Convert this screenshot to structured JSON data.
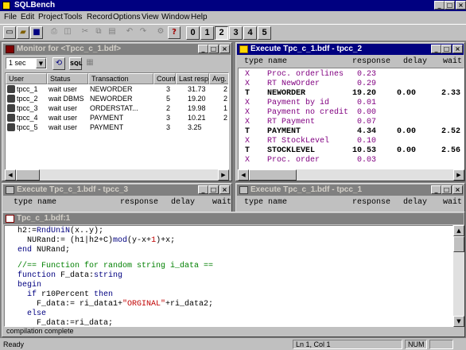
{
  "app": {
    "title": "SQLBench"
  },
  "menu": [
    "File",
    "Edit",
    "Project",
    "Tools",
    "Record",
    "Options",
    "View",
    "Window",
    "Help"
  ],
  "toolbar": {
    "tabs": [
      "0",
      "1",
      "2",
      "3",
      "4",
      "5"
    ],
    "active_tab": "2"
  },
  "monitor": {
    "title": "Monitor for <Tpcc_c_1.bdf>",
    "interval": "1 sec",
    "columns": [
      "User",
      "Status",
      "Transaction",
      "Count",
      "Last resp.",
      "Avg. r"
    ],
    "rows": [
      {
        "user": "tpcc_1",
        "status": "wait user",
        "transaction": "NEWORDER",
        "count": "3",
        "last": "31.73",
        "avg": "2"
      },
      {
        "user": "tpcc_2",
        "status": "wait DBMS",
        "transaction": "NEWORDER",
        "count": "5",
        "last": "19.20",
        "avg": "2"
      },
      {
        "user": "tpcc_3",
        "status": "wait user",
        "transaction": "ORDERSTAT...",
        "count": "2",
        "last": "19.98",
        "avg": "1"
      },
      {
        "user": "tpcc_4",
        "status": "wait user",
        "transaction": "PAYMENT",
        "count": "3",
        "last": "10.21",
        "avg": "2"
      },
      {
        "user": "tpcc_5",
        "status": "wait user",
        "transaction": "PAYMENT",
        "count": "3",
        "last": "3.25",
        "avg": ""
      }
    ]
  },
  "exec2": {
    "title": "Execute Tpc_c_1.bdf - tpcc_2",
    "columns": [
      "type",
      "name",
      "response",
      "delay",
      "wait"
    ],
    "rows": [
      {
        "type": "X",
        "name": "Proc. orderlines",
        "response": "0.23",
        "delay": "",
        "wait": "",
        "kind": "x"
      },
      {
        "type": "X",
        "name": "RT NewOrder",
        "response": "0.29",
        "delay": "",
        "wait": "",
        "kind": "x"
      },
      {
        "type": "T",
        "name": "NEWORDER",
        "response": "19.20",
        "delay": "0.00",
        "wait": "2.33",
        "kind": "t"
      },
      {
        "type": "X",
        "name": "Payment by id",
        "response": "0.01",
        "delay": "",
        "wait": "",
        "kind": "x"
      },
      {
        "type": "X",
        "name": "Payment no credit",
        "response": "0.00",
        "delay": "",
        "wait": "",
        "kind": "x"
      },
      {
        "type": "X",
        "name": "RT Payment",
        "response": "0.07",
        "delay": "",
        "wait": "",
        "kind": "x"
      },
      {
        "type": "T",
        "name": "PAYMENT",
        "response": "4.34",
        "delay": "0.00",
        "wait": "2.52",
        "kind": "t"
      },
      {
        "type": "X",
        "name": "RT StockLevel",
        "response": "0.10",
        "delay": "",
        "wait": "",
        "kind": "x"
      },
      {
        "type": "T",
        "name": "STOCKLEVEL",
        "response": "10.53",
        "delay": "0.00",
        "wait": "2.56",
        "kind": "t"
      },
      {
        "type": "X",
        "name": "Proc. order",
        "response": "0.03",
        "delay": "",
        "wait": "",
        "kind": "x"
      }
    ]
  },
  "exec3": {
    "title": "Execute Tpc_c_1.bdf - tpcc_3",
    "columns": [
      "type",
      "name",
      "response",
      "delay",
      "wait"
    ]
  },
  "exec1": {
    "title": "Execute Tpc_c_1.bdf - tpcc_1",
    "columns": [
      "type",
      "name",
      "response",
      "delay",
      "wait"
    ]
  },
  "editor": {
    "title": "Tpc_c_1.bdf:1",
    "message": "compilation complete"
  },
  "status": {
    "left": "Ready",
    "position": "Ln 1, Col 1",
    "num": "NUM"
  }
}
